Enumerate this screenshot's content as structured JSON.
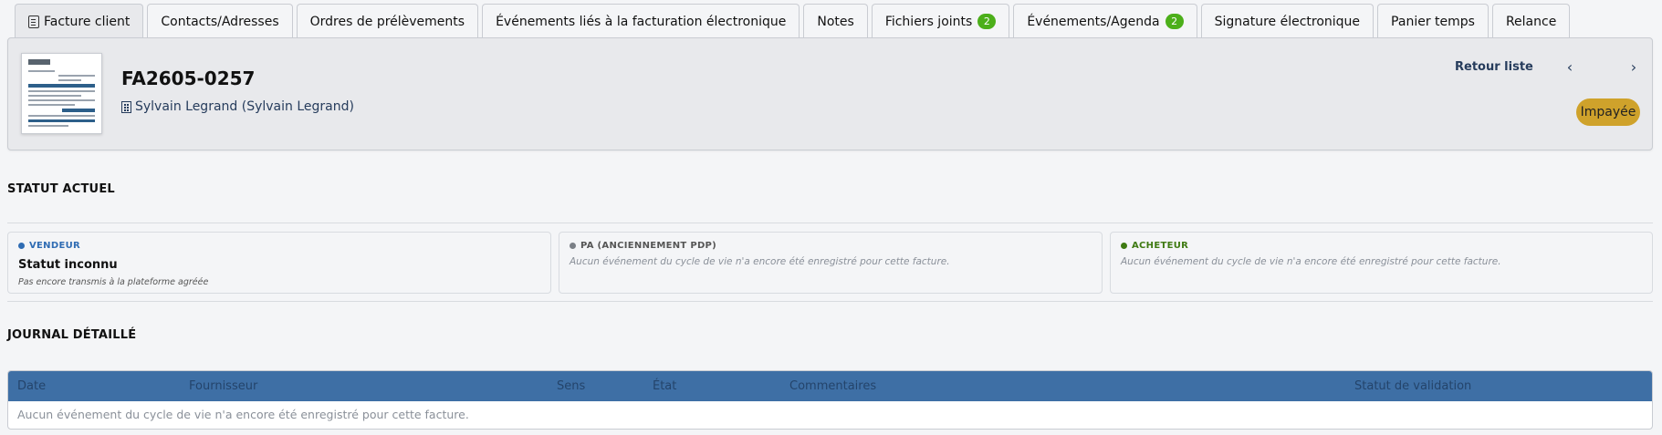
{
  "tabs": [
    {
      "label": "Facture client",
      "icon": "document-icon",
      "active": true
    },
    {
      "label": "Contacts/Adresses"
    },
    {
      "label": "Ordres de prélèvements"
    },
    {
      "label": "Événements liés à la facturation électronique"
    },
    {
      "label": "Notes"
    },
    {
      "label": "Fichiers joints",
      "badge": "2"
    },
    {
      "label": "Événements/Agenda",
      "badge": "2"
    },
    {
      "label": "Signature électronique"
    },
    {
      "label": "Panier temps"
    },
    {
      "label": "Relance"
    }
  ],
  "banner": {
    "ref": "FA2605-0257",
    "company": "Sylvain Legrand (Sylvain Legrand)",
    "back_label": "Retour liste",
    "prev_icon": "chevron-left-icon",
    "next_icon": "chevron-right-icon",
    "status": "Impayée"
  },
  "current_status": {
    "title": "STATUT ACTUEL",
    "cards": [
      {
        "label": "VENDEUR",
        "color": "#2f6cb3",
        "value": "Statut inconnu",
        "note": "Pas encore transmis à la plateforme agréée"
      },
      {
        "label": "PA (ANCIENNEMENT PDP)",
        "color": "#7a7f86",
        "empty": "Aucun événement du cycle de vie n'a encore été enregistré pour cette facture."
      },
      {
        "label": "ACHETEUR",
        "color": "#3e7a12",
        "empty": "Aucun événement du cycle de vie n'a encore été enregistré pour cette facture."
      }
    ]
  },
  "journal": {
    "title": "JOURNAL DÉTAILLÉ",
    "columns": [
      "Date",
      "Fournisseur",
      "Sens",
      "État",
      "Commentaires",
      "Statut de validation"
    ],
    "empty": "Aucun événement du cycle de vie n'a encore été enregistré pour cette facture."
  },
  "colors": {
    "accent": "#263c5c",
    "table_header": "#3e6fa5",
    "badge": "#4caf1a",
    "status_pill": "#cfa22b"
  }
}
